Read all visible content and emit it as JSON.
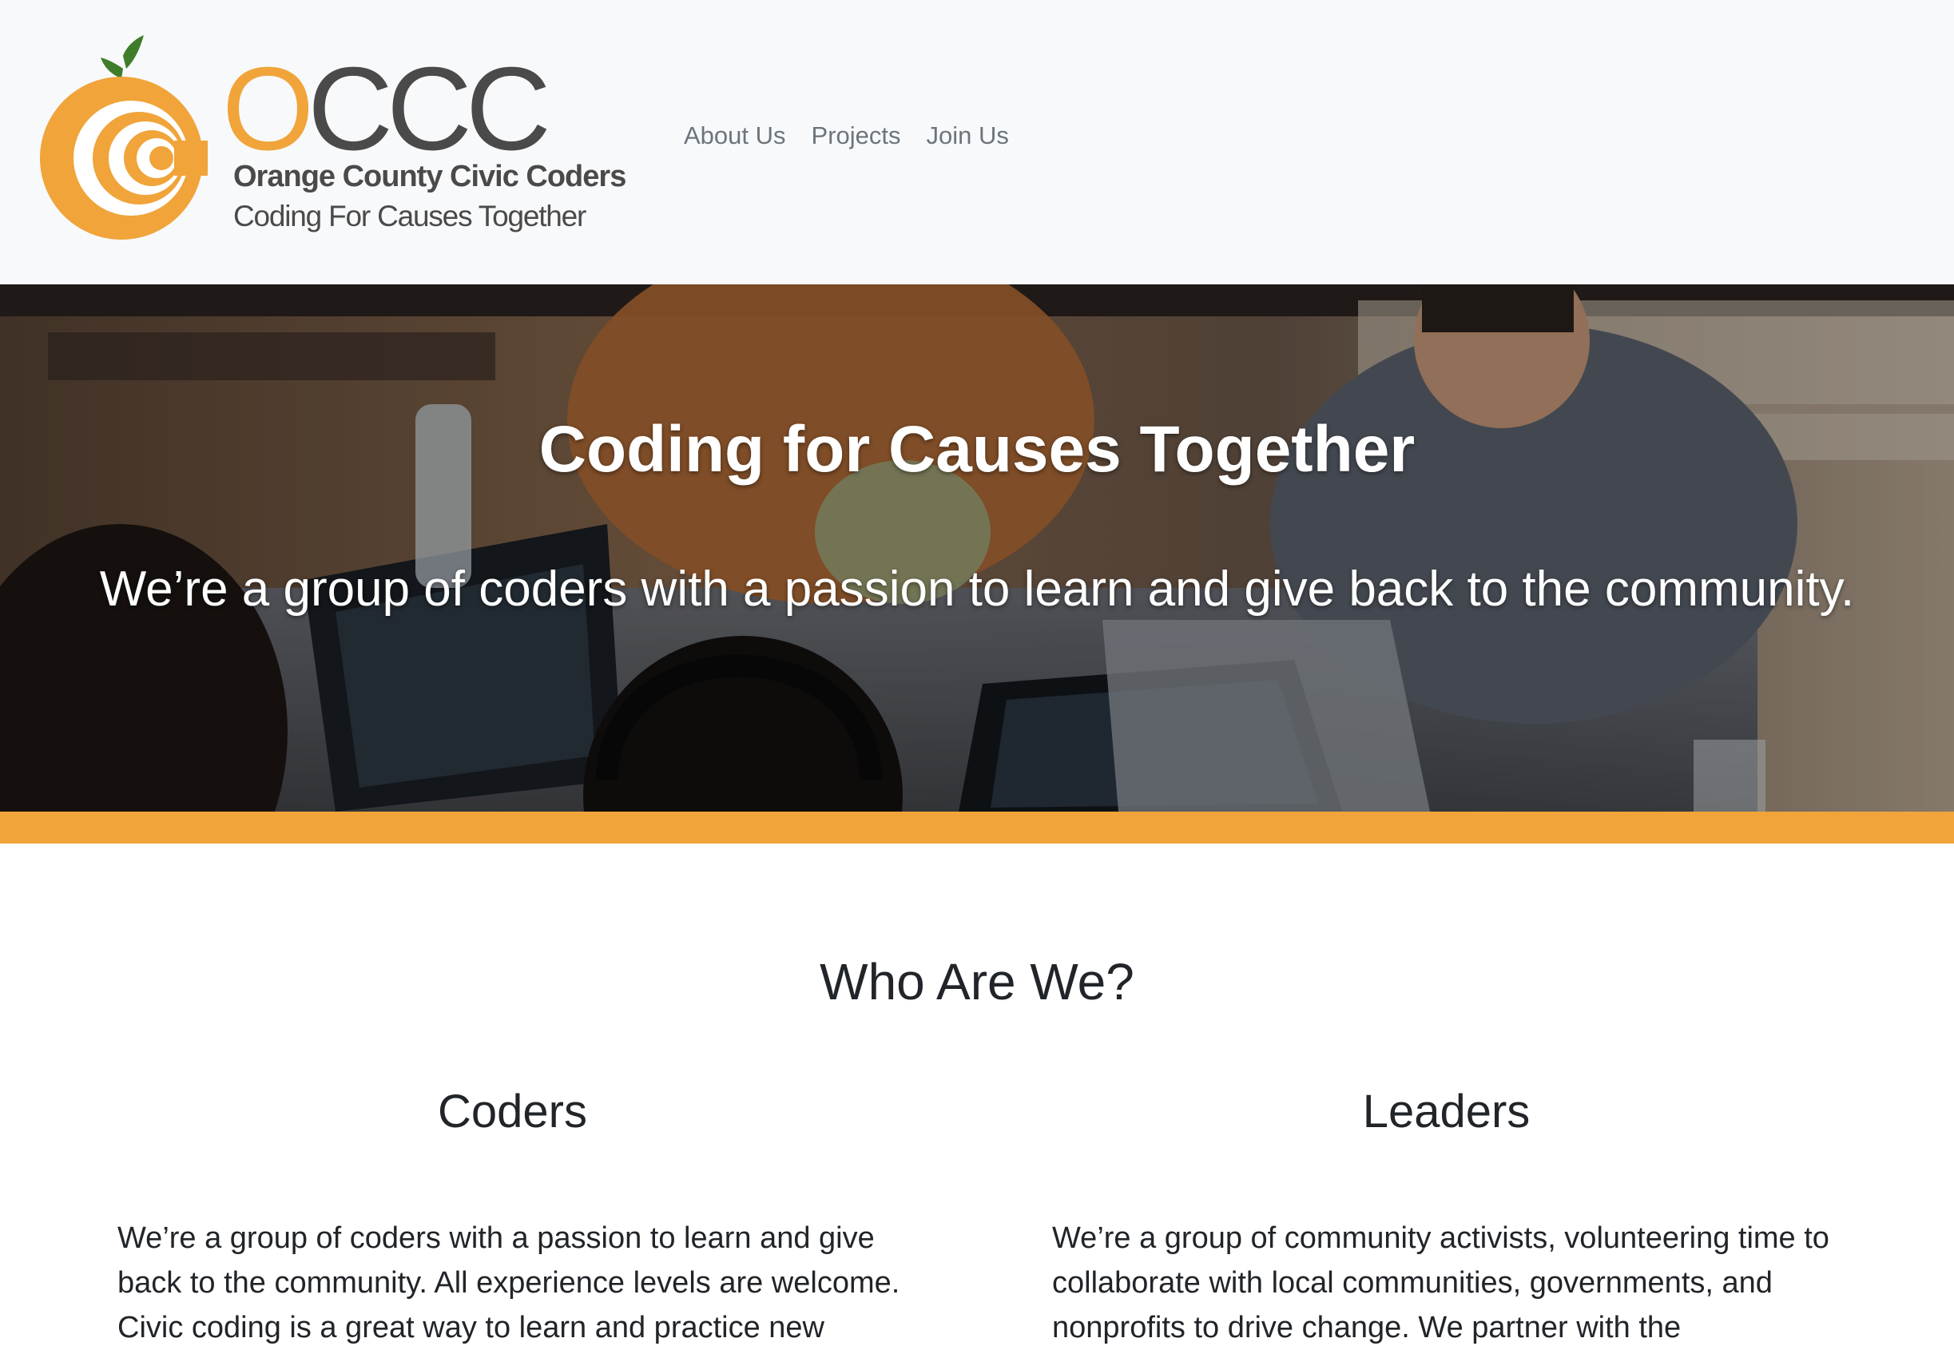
{
  "brand": {
    "abbr_first": "O",
    "abbr_rest": "CCC",
    "name": "Orange County Civic Coders",
    "tagline": "Coding For Causes Together",
    "colors": {
      "orange": "#f0a43a",
      "leaf": "#3f7d2a",
      "gray": "#4a4a4a"
    }
  },
  "nav": {
    "items": [
      {
        "label": "About Us"
      },
      {
        "label": "Projects"
      },
      {
        "label": "Join Us"
      }
    ]
  },
  "hero": {
    "title": "Coding for Causes Together",
    "subtitle": "We’re a group of coders with a passion to learn and give back to the community."
  },
  "about": {
    "heading": "Who Are We?",
    "columns": [
      {
        "title": "Coders",
        "lines": [
          "We’re a group of coders with a passion to learn and give",
          "back to the community. All experience levels are welcome.",
          "Civic coding is a great way to learn and practice new"
        ]
      },
      {
        "title": "Leaders",
        "lines": [
          "We’re a group of community activists, volunteering time to",
          "collaborate with local communities, governments, and",
          "nonprofits to drive change. We partner with the"
        ]
      }
    ]
  }
}
